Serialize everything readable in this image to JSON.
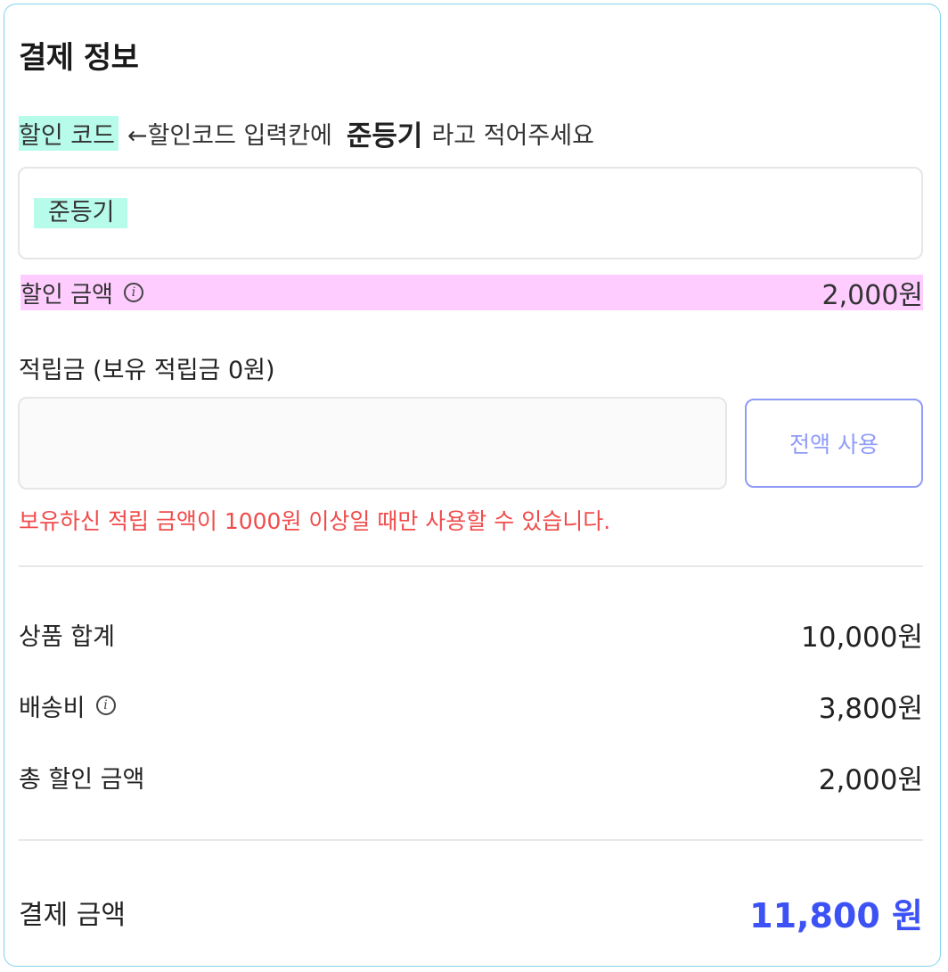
{
  "title": "결제 정보",
  "discount_code": {
    "label": "할인 코드",
    "hint": "←할인코드 입력칸에",
    "hint_code": "준등기",
    "hint_tail": "라고 적어주세요",
    "value": "준등기"
  },
  "discount": {
    "label": "할인 금액",
    "amount": "2,000원"
  },
  "points": {
    "label": "적립금  (보유 적립금 0원)",
    "input_value": "",
    "use_all_button": "전액 사용",
    "warning": "보유하신 적립 금액이 1000원 이상일 때만 사용할 수 있습니다."
  },
  "summary": {
    "subtotal_label": "상품 합계",
    "subtotal_value": "10,000원",
    "shipping_label": "배송비",
    "shipping_value": "3,800원",
    "total_discount_label": "총 할인 금액",
    "total_discount_value": "2,000원"
  },
  "total": {
    "label": "결제 금액",
    "value": "11,800 원"
  },
  "colors": {
    "code_highlight": "#b7fbea",
    "discount_highlight": "#ffccff",
    "accent_blue": "#3d52f5",
    "button_border": "#8f9bf7",
    "warning_red": "#f04b4b",
    "panel_border": "#7fd3ee"
  }
}
